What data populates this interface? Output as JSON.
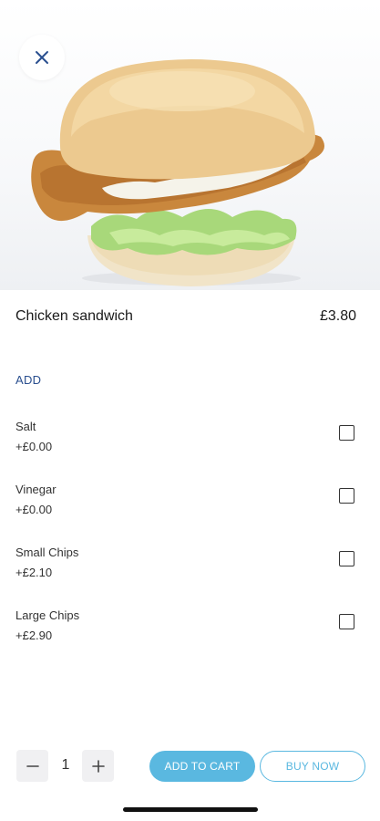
{
  "product": {
    "image_icon": "chicken-sandwich-photo",
    "close_icon": "close-icon",
    "name": "Chicken sandwich",
    "price": "£3.80"
  },
  "addons": {
    "section_label": "ADD",
    "options": [
      {
        "name": "Salt",
        "price": "+£0.00",
        "checked": false
      },
      {
        "name": "Vinegar",
        "price": "+£0.00",
        "checked": false
      },
      {
        "name": "Small Chips",
        "price": "+£2.10",
        "checked": false
      },
      {
        "name": "Large Chips",
        "price": "+£2.90",
        "checked": false
      }
    ]
  },
  "footer": {
    "quantity": "1",
    "minus_icon": "minus-icon",
    "plus_icon": "plus-icon",
    "add_to_cart_label": "ADD TO CART",
    "buy_now_label": "BUY NOW"
  },
  "colors": {
    "accent": "#5ab8e0",
    "section_label": "#2a4f8f",
    "text": "#1a1a1a"
  }
}
